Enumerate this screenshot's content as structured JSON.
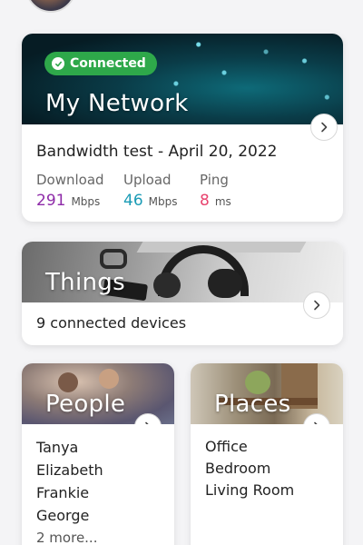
{
  "colors": {
    "connected_green": "#2ea84a",
    "download_purple": "#8e2ba8",
    "upload_teal": "#1a9bb5",
    "ping_pink": "#e8436e"
  },
  "network": {
    "status_badge": "Connected",
    "title": "My Network",
    "bandwidth_title": "Bandwidth test - April 20, 2022",
    "stats": [
      {
        "label": "Download",
        "value": "291",
        "unit": "Mbps"
      },
      {
        "label": "Upload",
        "value": "46",
        "unit": "Mbps"
      },
      {
        "label": "Ping",
        "value": "8",
        "unit": "ms"
      }
    ]
  },
  "things": {
    "title": "Things",
    "count_text": "9 connected devices"
  },
  "people": {
    "title": "People",
    "names": [
      "Tanya",
      "Elizabeth",
      "Frankie",
      "George"
    ],
    "more_text": "2 more..."
  },
  "places": {
    "title": "Places",
    "names": [
      "Office",
      "Bedroom",
      "Living Room"
    ]
  },
  "icons": {
    "chevron": "chevron-right-icon",
    "check": "check-circle-icon"
  }
}
